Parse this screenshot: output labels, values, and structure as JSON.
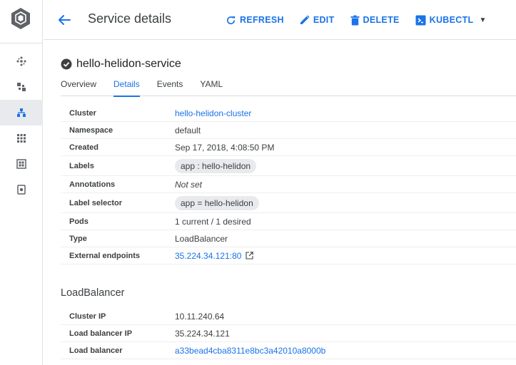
{
  "header": {
    "title": "Service details",
    "actions": {
      "refresh": "REFRESH",
      "edit": "EDIT",
      "delete": "DELETE",
      "kubectl": "KUBECTL"
    }
  },
  "sidebar": {
    "items": [
      {
        "icon": "clusters-icon"
      },
      {
        "icon": "workloads-icon"
      },
      {
        "icon": "services-icon",
        "active": true
      },
      {
        "icon": "applications-icon"
      },
      {
        "icon": "configuration-icon"
      },
      {
        "icon": "storage-icon"
      }
    ]
  },
  "resource": {
    "name": "hello-helidon-service",
    "status": "ok"
  },
  "tabs": [
    "Overview",
    "Details",
    "Events",
    "YAML"
  ],
  "active_tab": "Details",
  "details": {
    "cluster": {
      "label": "Cluster",
      "value": "hello-helidon-cluster"
    },
    "namespace": {
      "label": "Namespace",
      "value": "default"
    },
    "created": {
      "label": "Created",
      "value": "Sep 17, 2018, 4:08:50 PM"
    },
    "labels": {
      "label": "Labels",
      "value": "app : hello-helidon"
    },
    "annotations": {
      "label": "Annotations",
      "value": "Not set"
    },
    "label_selector": {
      "label": "Label selector",
      "value": "app = hello-helidon"
    },
    "pods": {
      "label": "Pods",
      "value": "1 current / 1 desired"
    },
    "type": {
      "label": "Type",
      "value": "LoadBalancer"
    },
    "external_endpoints": {
      "label": "External endpoints",
      "value": "35.224.34.121:80"
    }
  },
  "loadbalancer": {
    "title": "LoadBalancer",
    "cluster_ip": {
      "label": "Cluster IP",
      "value": "10.11.240.64"
    },
    "lb_ip": {
      "label": "Load balancer IP",
      "value": "35.224.34.121"
    },
    "lb": {
      "label": "Load balancer",
      "value": "a33bead4cba8311e8bc3a42010a8000b"
    }
  },
  "colors": {
    "accent": "#1a73e8",
    "text": "#3c4043"
  }
}
